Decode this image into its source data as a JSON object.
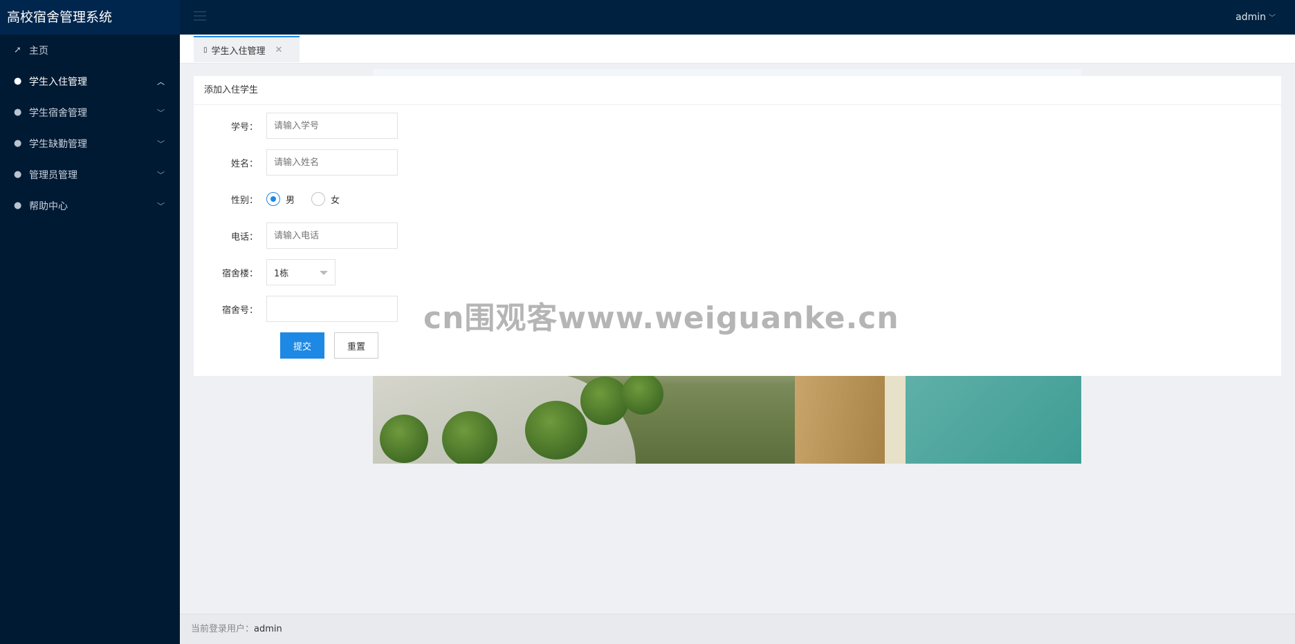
{
  "app": {
    "title": "高校宿舍管理系统"
  },
  "header": {
    "user": "admin"
  },
  "sidebar": {
    "items": [
      {
        "label": "主页",
        "icon": "paper-plane-icon",
        "expandable": false
      },
      {
        "label": "学生入住管理",
        "icon": "user-icon",
        "expandable": true,
        "open": true
      },
      {
        "label": "学生宿舍管理",
        "icon": "user-icon",
        "expandable": true
      },
      {
        "label": "学生缺勤管理",
        "icon": "user-icon",
        "expandable": true
      },
      {
        "label": "管理员管理",
        "icon": "user-icon",
        "expandable": true
      },
      {
        "label": "帮助中心",
        "icon": "user-icon",
        "expandable": true
      }
    ]
  },
  "tabs": [
    {
      "label": "学生入住管理",
      "active": true
    }
  ],
  "form": {
    "title": "添加入住学生",
    "student_id": {
      "label": "学号：",
      "placeholder": "请输入学号"
    },
    "name": {
      "label": "姓名：",
      "placeholder": "请输入姓名"
    },
    "gender": {
      "label": "性别：",
      "options": [
        "男",
        "女"
      ],
      "selected": "男"
    },
    "phone": {
      "label": "电话：",
      "placeholder": "请输入电话"
    },
    "building": {
      "label": "宿舍楼：",
      "value": "1栋"
    },
    "room": {
      "label": "宿舍号：",
      "value": ""
    },
    "submit_label": "提交",
    "reset_label": "重置"
  },
  "watermark": "cn围观客www.weiguanke.cn",
  "footer": {
    "prefix": "当前登录用户：",
    "user": "admin"
  },
  "colors": {
    "accent": "#1e88e5",
    "sidebar_bg": "#001a33",
    "header_bg": "#00213f"
  }
}
